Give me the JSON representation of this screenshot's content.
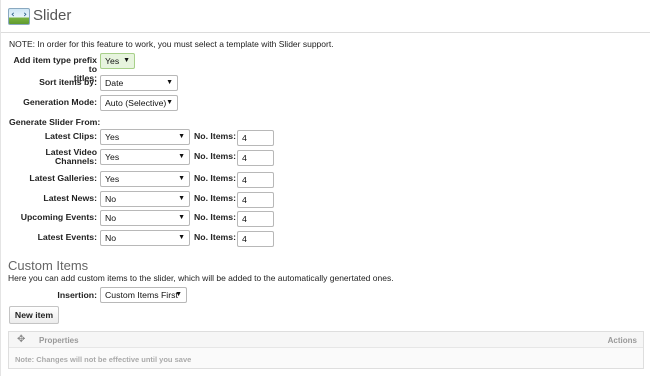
{
  "header": {
    "title": "Slider",
    "logo_icon": "slider-image-icon",
    "logo_left_glyph": "‹",
    "logo_right_glyph": "›"
  },
  "note": "NOTE: In order for this feature to work, you must select a template with Slider support.",
  "settings": {
    "prefix": {
      "label_line1": "Add item type prefix to",
      "label_line2": "titles:",
      "value": "Yes"
    },
    "sort": {
      "label": "Sort items by:",
      "value": "Date"
    },
    "mode": {
      "label": "Generation Mode:",
      "value": "Auto (Selective)"
    }
  },
  "generate": {
    "heading": "Generate Slider From:",
    "no_items_label": "No. Items:",
    "rows": [
      {
        "label_line1": "Latest Clips:",
        "label_line2": "",
        "value": "Yes",
        "count": "4"
      },
      {
        "label_line1": "Latest Video",
        "label_line2": "Channels:",
        "value": "Yes",
        "count": "4"
      },
      {
        "label_line1": "Latest Galleries:",
        "label_line2": "",
        "value": "Yes",
        "count": "4"
      },
      {
        "label_line1": "Latest News:",
        "label_line2": "",
        "value": "No",
        "count": "4"
      },
      {
        "label_line1": "Upcoming Events:",
        "label_line2": "",
        "value": "No",
        "count": "4"
      },
      {
        "label_line1": "Latest Events:",
        "label_line2": "",
        "value": "No",
        "count": "4"
      }
    ]
  },
  "custom": {
    "title": "Custom Items",
    "description": "Here you can add custom items to the slider, which will be added to the automatically genertated ones.",
    "insertion": {
      "label": "Insertion:",
      "value": "Custom Items First"
    },
    "new_item_label": "New item",
    "table": {
      "move_icon": "move-arrows-icon",
      "properties_header": "Properties",
      "actions_header": "Actions",
      "footer_note": "Note: Changes will not be effective until you save"
    }
  },
  "dropdown_arrow": "▼",
  "colors": {
    "yes_select_bg": "#e7f4de",
    "border": "#b8b8b8"
  }
}
